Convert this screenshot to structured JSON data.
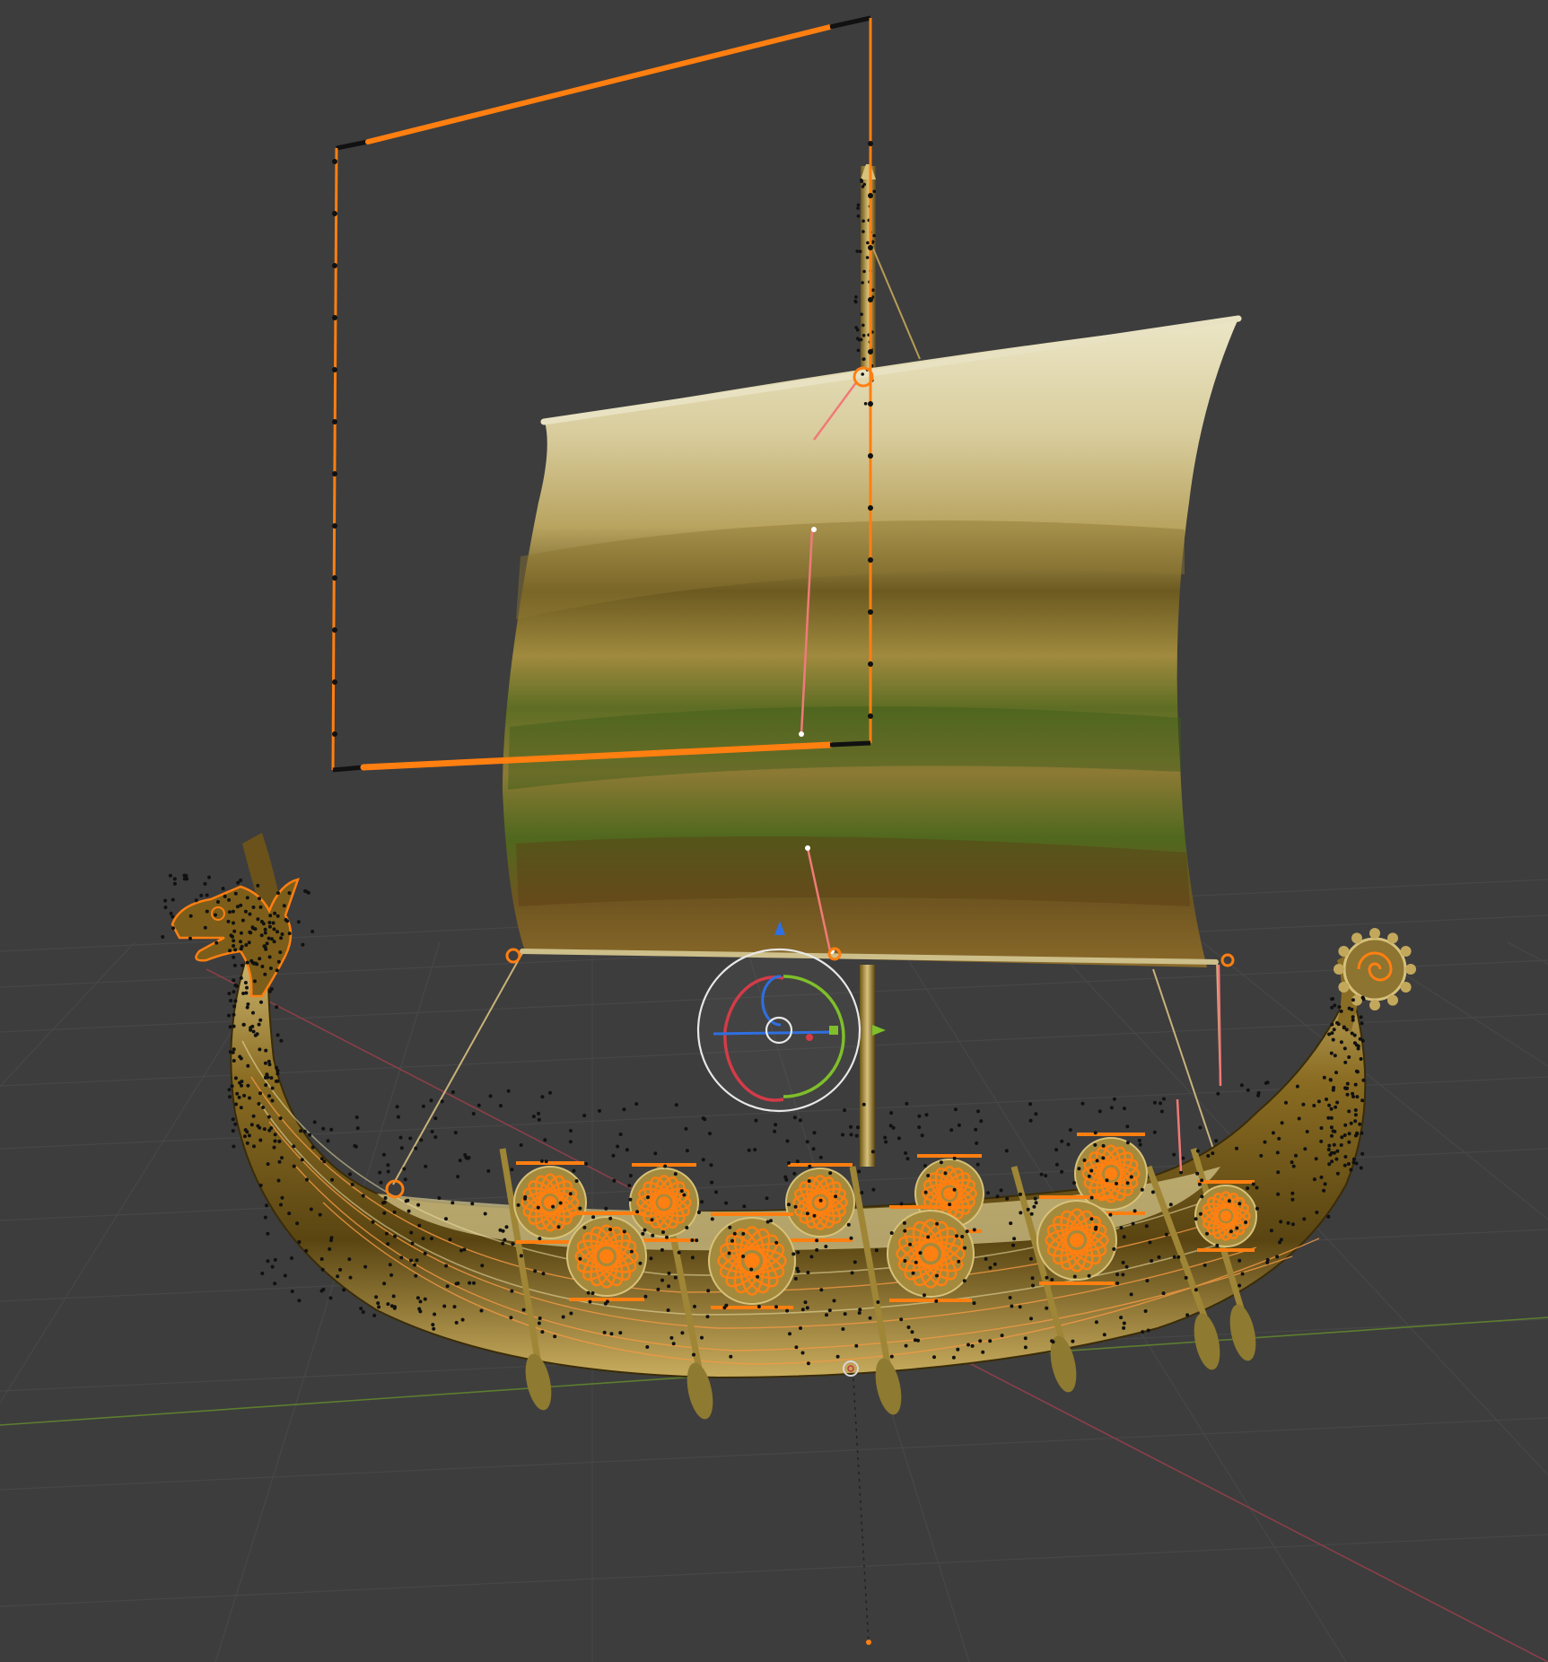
{
  "viewport": {
    "mode": "3d-viewport-edit-mode",
    "background": "#3d3d3d",
    "grid_color": "#474747",
    "axis_x_color": "#8a3f4a",
    "axis_y_color": "#5d7d2f"
  },
  "colors": {
    "selection": "#ff7f11",
    "selection_dark": "#e86a00",
    "vertex": "#111111",
    "hull_dark": "#4a3a0e",
    "hull_mid": "#8b6d22",
    "hull_light": "#d6bf77",
    "sail_top": "#e9e3c4",
    "sail_mid": "#6e5f22",
    "sail_green": "#4f6a20",
    "bone_pink": "#f07a78"
  },
  "objects": {
    "hull": "viking-ship-hull",
    "sail": "square-sail",
    "mast": "mast",
    "shields": 11,
    "oars": 6,
    "lattice": "lattice-cage"
  },
  "gizmo": {
    "type": "rotate-gizmo",
    "x_ring_color": "#d33b48",
    "y_ring_color": "#7fbf2a",
    "z_ring_color": "#2f6fe0",
    "outer_ring_color": "#e8e8e8"
  }
}
